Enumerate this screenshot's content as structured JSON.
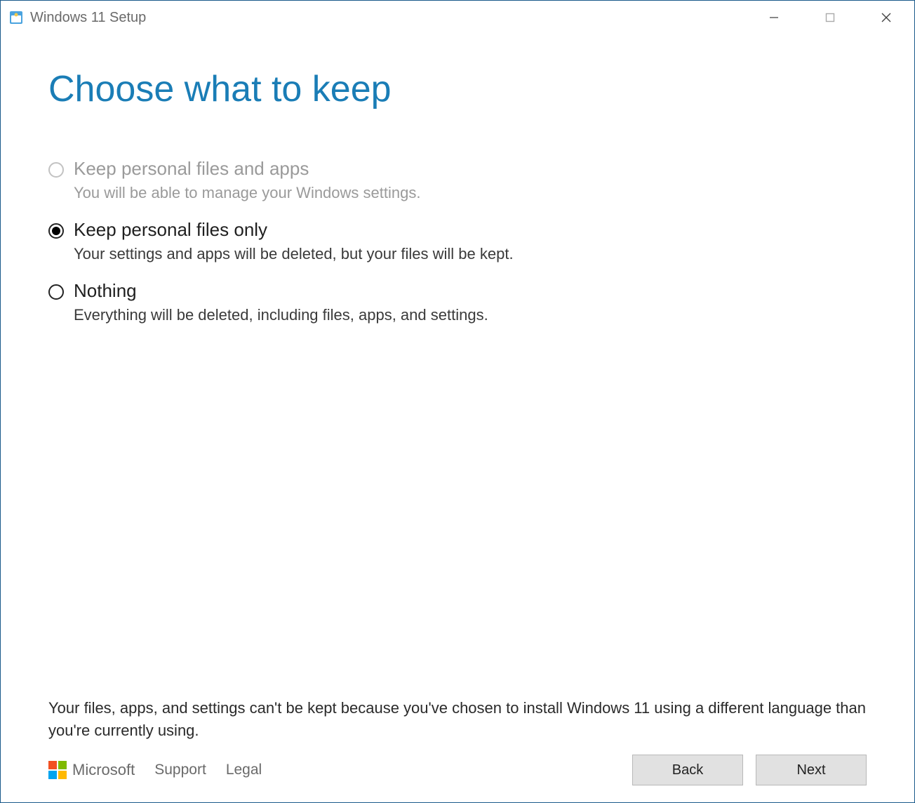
{
  "titlebar": {
    "title": "Windows 11 Setup"
  },
  "page": {
    "heading": "Choose what to keep"
  },
  "options": [
    {
      "label": "Keep personal files and apps",
      "desc": "You will be able to manage your Windows settings.",
      "disabled": true,
      "selected": false
    },
    {
      "label": "Keep personal files only",
      "desc": "Your settings and apps will be deleted, but your files will be kept.",
      "disabled": false,
      "selected": true
    },
    {
      "label": "Nothing",
      "desc": "Everything will be deleted, including files, apps, and settings.",
      "disabled": false,
      "selected": false
    }
  ],
  "footer": {
    "note": "Your files, apps, and settings can't be kept because you've chosen to install  Windows 11 using a different language than you're currently using.",
    "msbrand": "Microsoft",
    "support": "Support",
    "legal": "Legal",
    "back": "Back",
    "next": "Next"
  }
}
